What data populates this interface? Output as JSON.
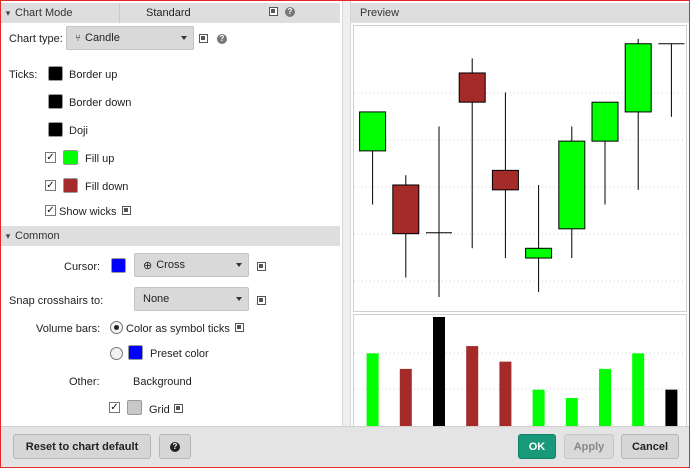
{
  "chart_mode": {
    "label": "Chart Mode",
    "value": "Standard"
  },
  "chart_type": {
    "label": "Chart type:",
    "value": "Candle",
    "icon": "candle-icon"
  },
  "ticks": {
    "label": "Ticks:",
    "items": [
      {
        "label": "Border up",
        "color": "#000000",
        "checked": null
      },
      {
        "label": "Border down",
        "color": "#000000",
        "checked": null
      },
      {
        "label": "Doji",
        "color": "#000000",
        "checked": null
      },
      {
        "label": "Fill up",
        "color": "#00ff00",
        "checked": true
      },
      {
        "label": "Fill down",
        "color": "#a52a2a",
        "checked": true
      }
    ],
    "show_wicks": {
      "label": "Show wicks",
      "checked": true
    }
  },
  "common": {
    "title": "Common",
    "cursor": {
      "label": "Cursor:",
      "color": "#0000ff",
      "value": "Cross",
      "icon": "crosshair-icon"
    },
    "snap": {
      "label": "Snap crosshairs to:",
      "value": "None"
    },
    "volume_bars": {
      "label": "Volume bars:",
      "options": [
        {
          "label": "Color as symbol ticks",
          "selected": true
        },
        {
          "label": "Preset color",
          "selected": false,
          "color": "#0000ff"
        }
      ]
    },
    "other": {
      "label": "Other:",
      "background_label": "Background",
      "grid": {
        "label": "Grid",
        "checked": true,
        "color": "#c8c8c8"
      }
    }
  },
  "preview": {
    "title": "Preview"
  },
  "footer": {
    "reset_label": "Reset to chart default",
    "help_glyph": "?",
    "ok_label": "OK",
    "apply_label": "Apply",
    "cancel_label": "Cancel"
  },
  "chart_data": {
    "type": "candlestick",
    "colors": {
      "up": "#00ff00",
      "down": "#a52a2a",
      "doji": "#000000"
    },
    "candles": [
      {
        "o": 150,
        "h": 180,
        "l": 95,
        "c": 190,
        "dir": "up"
      },
      {
        "o": 115,
        "h": 125,
        "l": 20,
        "c": 65,
        "dir": "down"
      },
      {
        "o": 66,
        "h": 175,
        "l": 0,
        "c": 66,
        "dir": "doji"
      },
      {
        "o": 230,
        "h": 245,
        "l": 50,
        "c": 200,
        "dir": "down"
      },
      {
        "o": 130,
        "h": 210,
        "l": 40,
        "c": 110,
        "dir": "down"
      },
      {
        "o": 40,
        "h": 115,
        "l": 5,
        "c": 50,
        "dir": "up"
      },
      {
        "o": 70,
        "h": 175,
        "l": 40,
        "c": 160,
        "dir": "up"
      },
      {
        "o": 160,
        "h": 200,
        "l": 95,
        "c": 200,
        "dir": "up"
      },
      {
        "o": 190,
        "h": 265,
        "l": 110,
        "c": 260,
        "dir": "up"
      },
      {
        "o": 260,
        "h": 260,
        "l": 185,
        "c": 260,
        "dir": "doji"
      }
    ],
    "ylim": [
      0,
      270
    ],
    "volume": [
      {
        "v": 70,
        "dir": "up"
      },
      {
        "v": 55,
        "dir": "down"
      },
      {
        "v": 105,
        "dir": "doji"
      },
      {
        "v": 77,
        "dir": "down"
      },
      {
        "v": 62,
        "dir": "down"
      },
      {
        "v": 35,
        "dir": "up"
      },
      {
        "v": 27,
        "dir": "up"
      },
      {
        "v": 55,
        "dir": "up"
      },
      {
        "v": 70,
        "dir": "up"
      },
      {
        "v": 35,
        "dir": "doji"
      }
    ],
    "vlim": [
      0,
      105
    ],
    "grid": true
  }
}
